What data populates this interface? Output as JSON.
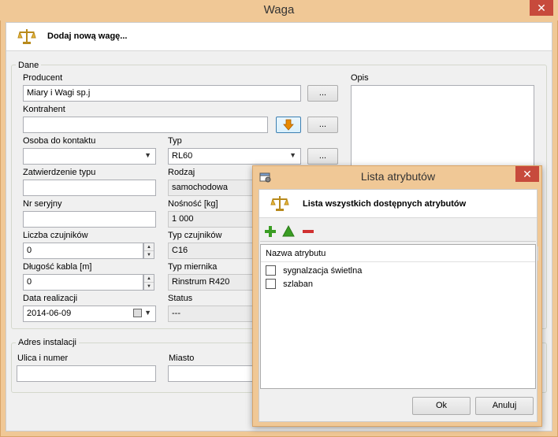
{
  "main_window": {
    "title": "Waga",
    "close_glyph": "✕",
    "header_text": "Dodaj nową wagę...",
    "icon": "scale-icon"
  },
  "dane": {
    "legend": "Dane",
    "producent_label": "Producent",
    "producent_value": "Miary i Wagi sp.j",
    "kontrahent_label": "Kontrahent",
    "kontrahent_value": "",
    "browse_label": "...",
    "osoba_label": "Osoba do kontaktu",
    "osoba_value": "",
    "typ_label": "Typ",
    "typ_value": "RL60",
    "zatwierdzenie_label": "Zatwierdzenie typu",
    "zatwierdzenie_value": "",
    "rodzaj_label": "Rodzaj",
    "rodzaj_value": "samochodowa",
    "nr_label": "Nr seryjny",
    "nr_value": "",
    "nosnosc_label": "Nośność [kg]",
    "nosnosc_value": "1 000",
    "liczba_label": "Liczba czujników",
    "liczba_value": "0",
    "typ_czujnikow_label": "Typ czujników",
    "typ_czujnikow_value": "C16",
    "dlugosc_label": "Długość kabla [m]",
    "dlugosc_value": "0",
    "typ_miernika_label": "Typ miernika",
    "typ_miernika_value": "Rinstrum R420",
    "data_label": "Data realizacji",
    "data_value": "2014-06-09",
    "status_label": "Status",
    "status_value": "---",
    "opis_label": "Opis",
    "opis_value": ""
  },
  "adres": {
    "legend": "Adres instalacji",
    "ulica_label": "Ulica i numer",
    "ulica_value": "",
    "miasto_label": "Miasto",
    "miasto_value": ""
  },
  "dialog": {
    "title": "Lista atrybutów",
    "close_glyph": "✕",
    "header_text": "Lista wszystkich dostępnych atrybutów",
    "column_header": "Nazwa atrybutu",
    "items": [
      {
        "label": "sygnalzacja świetlna",
        "checked": false
      },
      {
        "label": "szlaban",
        "checked": false
      }
    ],
    "ok_label": "Ok",
    "cancel_label": "Anuluj"
  },
  "colors": {
    "title_bar": "#f0c896",
    "close_button": "#c74a3c",
    "add_icon": "#3a9d23",
    "up_icon": "#3a9d23",
    "remove_icon": "#d03030",
    "arrow_orange": "#e88a00"
  }
}
